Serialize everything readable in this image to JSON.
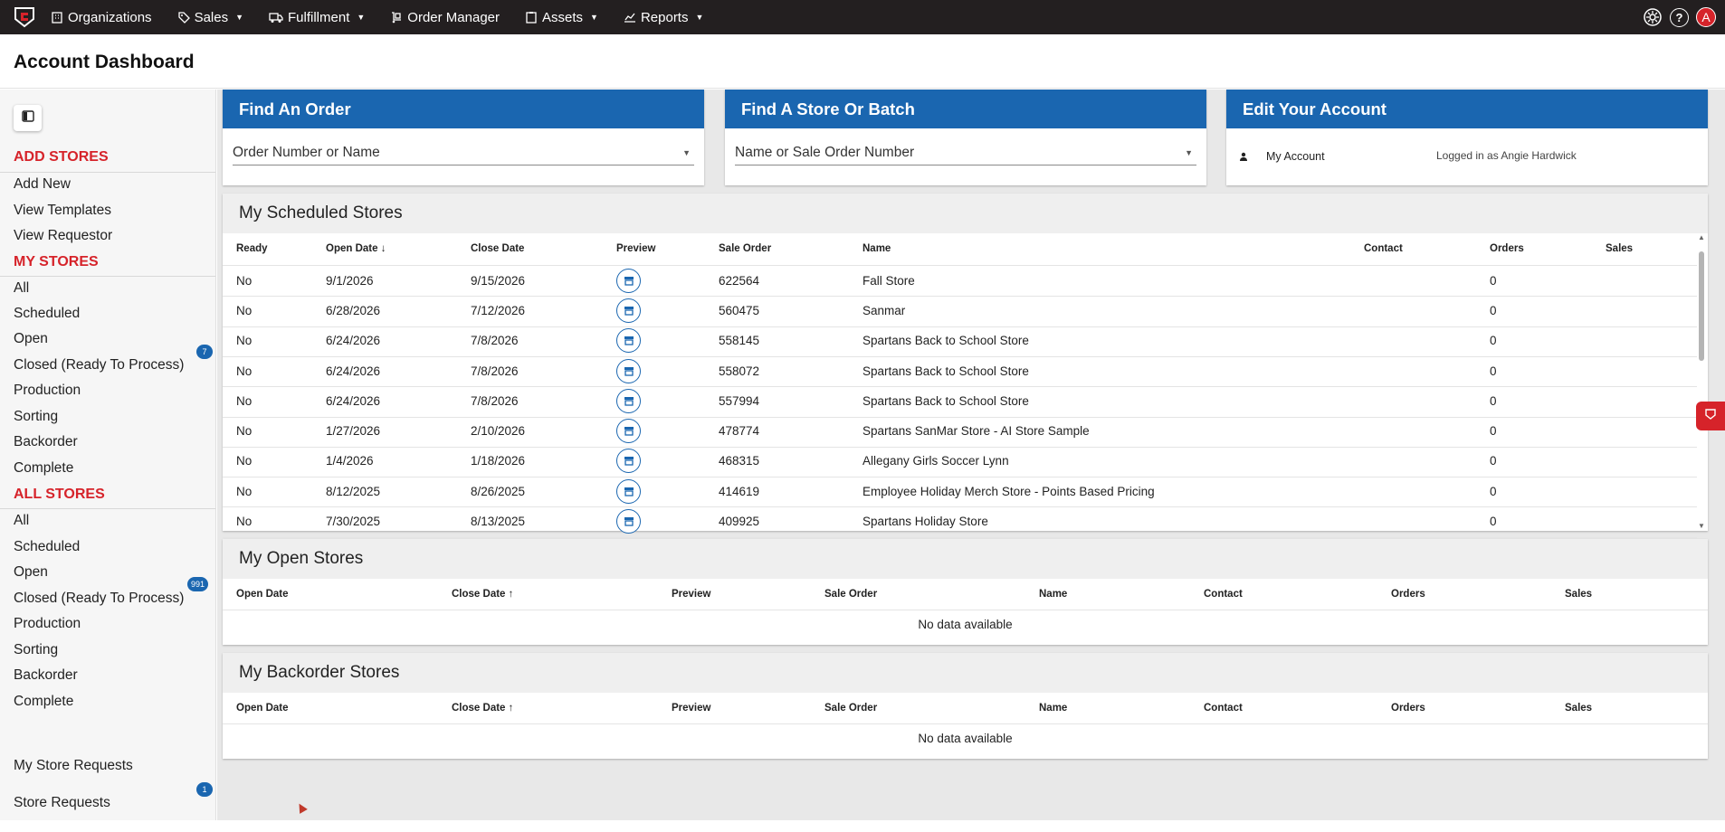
{
  "nav": {
    "items": [
      {
        "label": "Organizations",
        "icon": "building-icon",
        "caret": false
      },
      {
        "label": "Sales",
        "icon": "tag-icon",
        "caret": true
      },
      {
        "label": "Fulfillment",
        "icon": "truck-icon",
        "caret": true
      },
      {
        "label": "Order Manager",
        "icon": "hand-truck-icon",
        "caret": false
      },
      {
        "label": "Assets",
        "icon": "clipboard-icon",
        "caret": true
      },
      {
        "label": "Reports",
        "icon": "chart-icon",
        "caret": true
      }
    ],
    "avatar_letter": "A",
    "help_glyph": "?"
  },
  "page": {
    "title": "Account Dashboard"
  },
  "sidebar": {
    "sections": [
      {
        "heading": "ADD STORES",
        "items": [
          "Add New",
          "View Templates",
          "View Requestor"
        ]
      },
      {
        "heading": "MY STORES",
        "items": [
          "All",
          "Scheduled",
          "Open",
          "Closed (Ready To Process)",
          "Production",
          "Sorting",
          "Backorder",
          "Complete"
        ]
      },
      {
        "heading": "ALL STORES",
        "items": [
          "All",
          "Scheduled",
          "Open",
          "Closed (Ready To Process)",
          "Production",
          "Sorting",
          "Backorder",
          "Complete"
        ]
      }
    ],
    "badges": {
      "my_open": "7",
      "all_closed": "991",
      "store_requests": "1"
    },
    "footer": [
      "My Store Requests",
      "Store Requests"
    ]
  },
  "cards": {
    "find_order": {
      "title": "Find An Order",
      "placeholder": "Order Number or Name"
    },
    "find_store": {
      "title": "Find A Store Or Batch",
      "placeholder": "Name or Sale Order Number"
    },
    "edit_account": {
      "title": "Edit Your Account",
      "link": "My Account",
      "status": "Logged in as Angie Hardwick"
    }
  },
  "scheduled": {
    "title": "My Scheduled Stores",
    "columns": [
      "Ready",
      "Open Date",
      "Close Date",
      "Preview",
      "Sale Order",
      "Name",
      "Contact",
      "Orders",
      "Sales"
    ],
    "rows": [
      {
        "ready": "No",
        "open": "9/1/2026",
        "close": "9/15/2026",
        "sale_order": "622564",
        "name": "Fall Store",
        "contact": "",
        "orders": "0",
        "sales": ""
      },
      {
        "ready": "No",
        "open": "6/28/2026",
        "close": "7/12/2026",
        "sale_order": "560475",
        "name": "Sanmar",
        "contact": "",
        "orders": "0",
        "sales": ""
      },
      {
        "ready": "No",
        "open": "6/24/2026",
        "close": "7/8/2026",
        "sale_order": "558145",
        "name": "Spartans Back to School Store",
        "contact": "",
        "orders": "0",
        "sales": ""
      },
      {
        "ready": "No",
        "open": "6/24/2026",
        "close": "7/8/2026",
        "sale_order": "558072",
        "name": "Spartans Back to School Store",
        "contact": "",
        "orders": "0",
        "sales": ""
      },
      {
        "ready": "No",
        "open": "6/24/2026",
        "close": "7/8/2026",
        "sale_order": "557994",
        "name": "Spartans Back to School Store",
        "contact": "",
        "orders": "0",
        "sales": ""
      },
      {
        "ready": "No",
        "open": "1/27/2026",
        "close": "2/10/2026",
        "sale_order": "478774",
        "name": "Spartans SanMar Store - AI Store Sample",
        "contact": "",
        "orders": "0",
        "sales": ""
      },
      {
        "ready": "No",
        "open": "1/4/2026",
        "close": "1/18/2026",
        "sale_order": "468315",
        "name": "Allegany Girls Soccer Lynn",
        "contact": "",
        "orders": "0",
        "sales": ""
      },
      {
        "ready": "No",
        "open": "8/12/2025",
        "close": "8/26/2025",
        "sale_order": "414619",
        "name": "Employee Holiday Merch Store - Points Based Pricing",
        "contact": "",
        "orders": "0",
        "sales": ""
      },
      {
        "ready": "No",
        "open": "7/30/2025",
        "close": "8/13/2025",
        "sale_order": "409925",
        "name": "Spartans Holiday Store",
        "contact": "",
        "orders": "0",
        "sales": ""
      }
    ]
  },
  "open_stores": {
    "title": "My Open Stores",
    "columns": [
      "Open Date",
      "Close Date",
      "Preview",
      "Sale Order",
      "Name",
      "Contact",
      "Orders",
      "Sales"
    ],
    "empty": "No data available"
  },
  "backorder_stores": {
    "title": "My Backorder Stores",
    "columns": [
      "Open Date",
      "Close Date",
      "Preview",
      "Sale Order",
      "Name",
      "Contact",
      "Orders",
      "Sales"
    ],
    "empty": "No data available"
  },
  "colors": {
    "nav_bg": "#231f20",
    "brand_blue": "#1a66b0",
    "accent_red": "#d6232a"
  }
}
